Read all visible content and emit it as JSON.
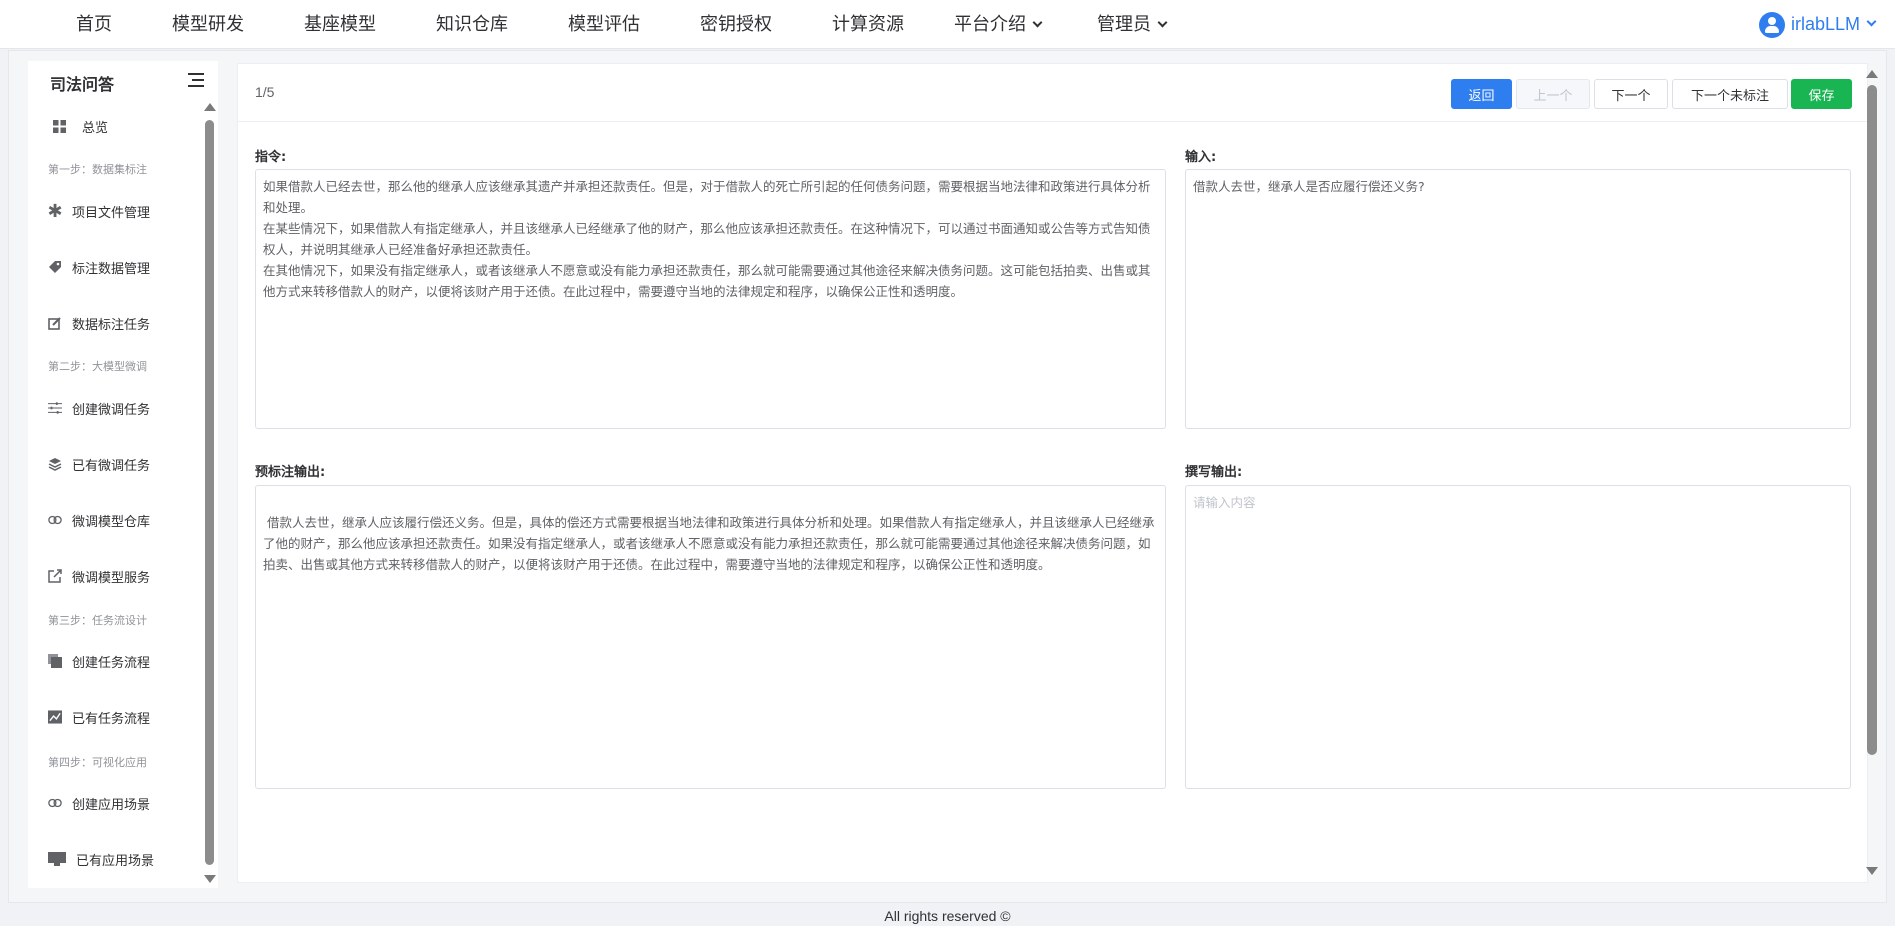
{
  "nav": {
    "items": [
      "首页",
      "模型研发",
      "基座模型",
      "知识仓库",
      "模型评估",
      "密钥授权",
      "计算资源"
    ],
    "dropdowns": [
      "平台介绍",
      "管理员"
    ],
    "user": "irlabLLM"
  },
  "sidebar": {
    "title": "司法问答",
    "overview": "总览",
    "step1": "第一步：数据集标注",
    "step1_items": [
      "项目文件管理",
      "标注数据管理",
      "数据标注任务"
    ],
    "step2": "第二步：大模型微调",
    "step2_items": [
      "创建微调任务",
      "已有微调任务",
      "微调模型仓库",
      "微调模型服务"
    ],
    "step3": "第三步：任务流设计",
    "step3_items": [
      "创建任务流程",
      "已有任务流程"
    ],
    "step4": "第四步：可视化应用",
    "step4_items": [
      "创建应用场景",
      "已有应用场景"
    ]
  },
  "toolbar": {
    "pager": "1/5",
    "back": "返回",
    "prev": "上一个",
    "next": "下一个",
    "next_unlabeled": "下一个未标注",
    "save": "保存"
  },
  "form": {
    "instruction_label": "指令:",
    "instruction_lines": [
      "如果借款人已经去世，那么他的继承人应该继承其遗产并承担还款责任。但是，对于借款人的死亡所引起的任何债务问题，需要根据当地法律和政策进行具体分析和处理。",
      "在某些情况下，如果借款人有指定继承人，并且该继承人已经继承了他的财产，那么他应该承担还款责任。在这种情况下，可以通过书面通知或公告等方式告知债权人，并说明其继承人已经准备好承担还款责任。",
      "在其他情况下，如果没有指定继承人，或者该继承人不愿意或没有能力承担还款责任，那么就可能需要通过其他途径来解决债务问题。这可能包括拍卖、出售或其他方式来转移借款人的财产，以便将该财产用于还债。在此过程中，需要遵守当地的法律规定和程序，以确保公正性和透明度。"
    ],
    "input_label": "输入:",
    "input_text": "借款人去世，继承人是否应履行偿还义务?",
    "pre_output_label": "预标注输出:",
    "pre_output_text": " 借款人去世，继承人应该履行偿还义务。但是，具体的偿还方式需要根据当地法律和政策进行具体分析和处理。如果借款人有指定继承人，并且该继承人已经继承了他的财产，那么他应该承担还款责任。如果没有指定继承人，或者该继承人不愿意或没有能力承担还款责任，那么就可能需要通过其他途径来解决债务问题，如拍卖、出售或其他方式来转移借款人的财产，以便将该财产用于还债。在此过程中，需要遵守当地的法律规定和程序，以确保公正性和透明度。",
    "write_output_label": "撰写输出:",
    "write_output_placeholder": "请输入内容"
  },
  "footer": "All rights reserved ©"
}
